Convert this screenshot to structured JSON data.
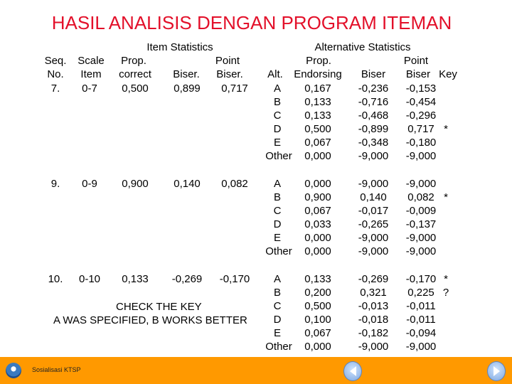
{
  "title": "HASIL ANALISIS DENGAN PROGRAM ITEMAN",
  "headers": {
    "item_stats": "Item Statistics",
    "alt_stats": "Alternative Statistics",
    "seq": "Seq.",
    "no": "No.",
    "scale": "Scale",
    "item": "Item",
    "prop": "Prop.",
    "correct": "correct",
    "biser": "Biser.",
    "point": "Point",
    "pbiser": "Biser.",
    "alt": "Alt.",
    "alt_prop": "Prop.",
    "endorsing": "Endorsing",
    "alt_biser": "Biser",
    "alt_point": "Point",
    "alt_pbiser": "Biser",
    "key": "Key"
  },
  "blocks": [
    {
      "seq": "7.",
      "scale": "0-7",
      "prop": "0,500",
      "biser": "0,899",
      "pbiser": "0,717",
      "alts": [
        [
          "A",
          "0,167",
          "-0,236",
          "-0,153",
          ""
        ],
        [
          "B",
          "0,133",
          "-0,716",
          "-0,454",
          ""
        ],
        [
          "C",
          "0,133",
          "-0,468",
          "-0,296",
          ""
        ],
        [
          "D",
          "0,500",
          "-0,899",
          "0,717",
          "*"
        ],
        [
          "E",
          "0,067",
          "-0,348",
          "-0,180",
          ""
        ],
        [
          "Other",
          "0,000",
          "-9,000",
          "-9,000",
          ""
        ]
      ]
    },
    {
      "seq": "9.",
      "scale": "0-9",
      "prop": "0,900",
      "biser": "0,140",
      "pbiser": "0,082",
      "alts": [
        [
          "A",
          "0,000",
          "-9,000",
          "-9,000",
          ""
        ],
        [
          "B",
          "0,900",
          "0,140",
          "0,082",
          "*"
        ],
        [
          "C",
          "0,067",
          "-0,017",
          "-0,009",
          ""
        ],
        [
          "D",
          "0,033",
          "-0,265",
          "-0,137",
          ""
        ],
        [
          "E",
          "0,000",
          "-9,000",
          "-9,000",
          ""
        ],
        [
          "Other",
          "0,000",
          "-9,000",
          "-9,000",
          ""
        ]
      ]
    },
    {
      "seq": "10.",
      "scale": "0-10",
      "prop": "0,133",
      "biser": "-0,269",
      "pbiser": "-0,170",
      "alts": [
        [
          "A",
          "0,133",
          "-0,269",
          "-0,170",
          "*"
        ],
        [
          "B",
          "0,200",
          "0,321",
          "0,225",
          "?"
        ],
        [
          "C",
          "0,500",
          "-0,013",
          "-0,011",
          ""
        ],
        [
          "D",
          "0,100",
          "-0,018",
          "-0,011",
          ""
        ],
        [
          "E",
          "0,067",
          "-0,182",
          "-0,094",
          ""
        ],
        [
          "Other",
          "0,000",
          "-9,000",
          "-9,000",
          ""
        ]
      ]
    }
  ],
  "notes": {
    "check": "CHECK THE KEY",
    "spec": "A WAS SPECIFIED, B WORKS BETTER"
  },
  "footer": {
    "label": "Sosialisasi KTSP",
    "logo_text": "Tut Wuri Handayani",
    "prev_icon": "left-arrow",
    "next_icon": "right-arrow",
    "bar_color": "#ff9900"
  }
}
